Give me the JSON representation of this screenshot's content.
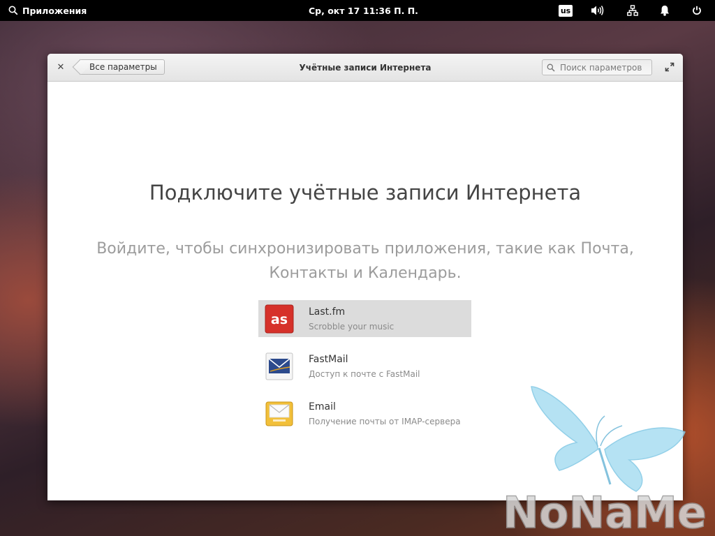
{
  "panel": {
    "apps_label": "Приложения",
    "date": "Ср, окт 17",
    "time": "11:36 П. П.",
    "keyboard_layout": "us"
  },
  "window": {
    "back_label": "Все параметры",
    "title": "Учётные записи Интернета",
    "search_placeholder": "Поиск параметров"
  },
  "content": {
    "headline": "Подключите учётные записи Интернета",
    "subline": "Войдите, чтобы синхронизировать приложения, такие как Почта, Контакты и Календарь."
  },
  "providers": [
    {
      "name": "Last.fm",
      "desc": "Scrobble your music",
      "icon": "lastfm-icon",
      "selected": true
    },
    {
      "name": "FastMail",
      "desc": "Доступ к почте с FastMail",
      "icon": "fastmail-icon",
      "selected": false
    },
    {
      "name": "Email",
      "desc": "Получение почты от IMAP-сервера",
      "icon": "email-icon",
      "selected": false
    }
  ],
  "watermark": {
    "text": "NoNaMe"
  },
  "colors": {
    "lastfm": "#d6312a",
    "fastmail": "#2c4a8c",
    "email": "#f2c03a",
    "selected_row": "#dcdcdc"
  }
}
